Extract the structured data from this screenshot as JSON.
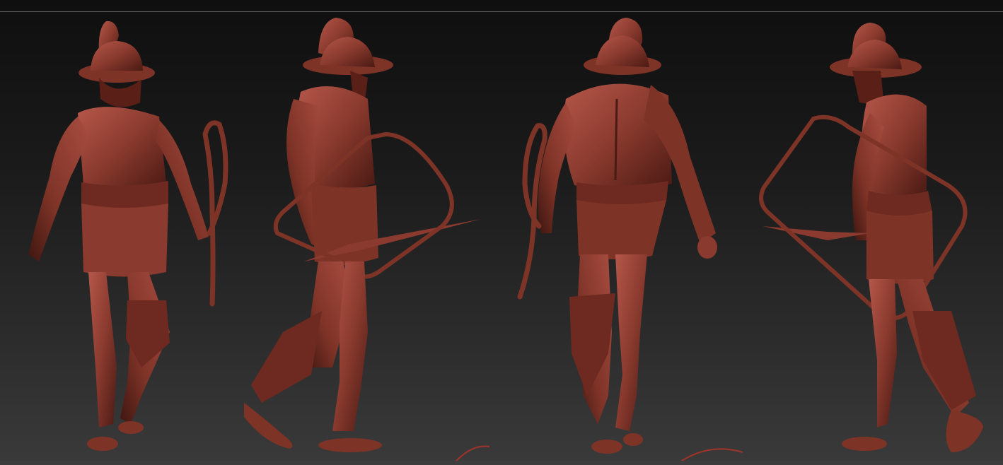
{
  "scene": {
    "render_color": "#8a3a2e",
    "shadow_color": "#4a1a14",
    "highlight_color": "#b5574a",
    "background_top": "#0f0f0f",
    "background_bottom": "#3a3a3a",
    "views": [
      {
        "id": "front",
        "icon": "gladiator-figure-front"
      },
      {
        "id": "side-left",
        "icon": "gladiator-figure-side"
      },
      {
        "id": "back",
        "icon": "gladiator-figure-back"
      },
      {
        "id": "side-right",
        "icon": "gladiator-figure-side-right"
      }
    ]
  }
}
